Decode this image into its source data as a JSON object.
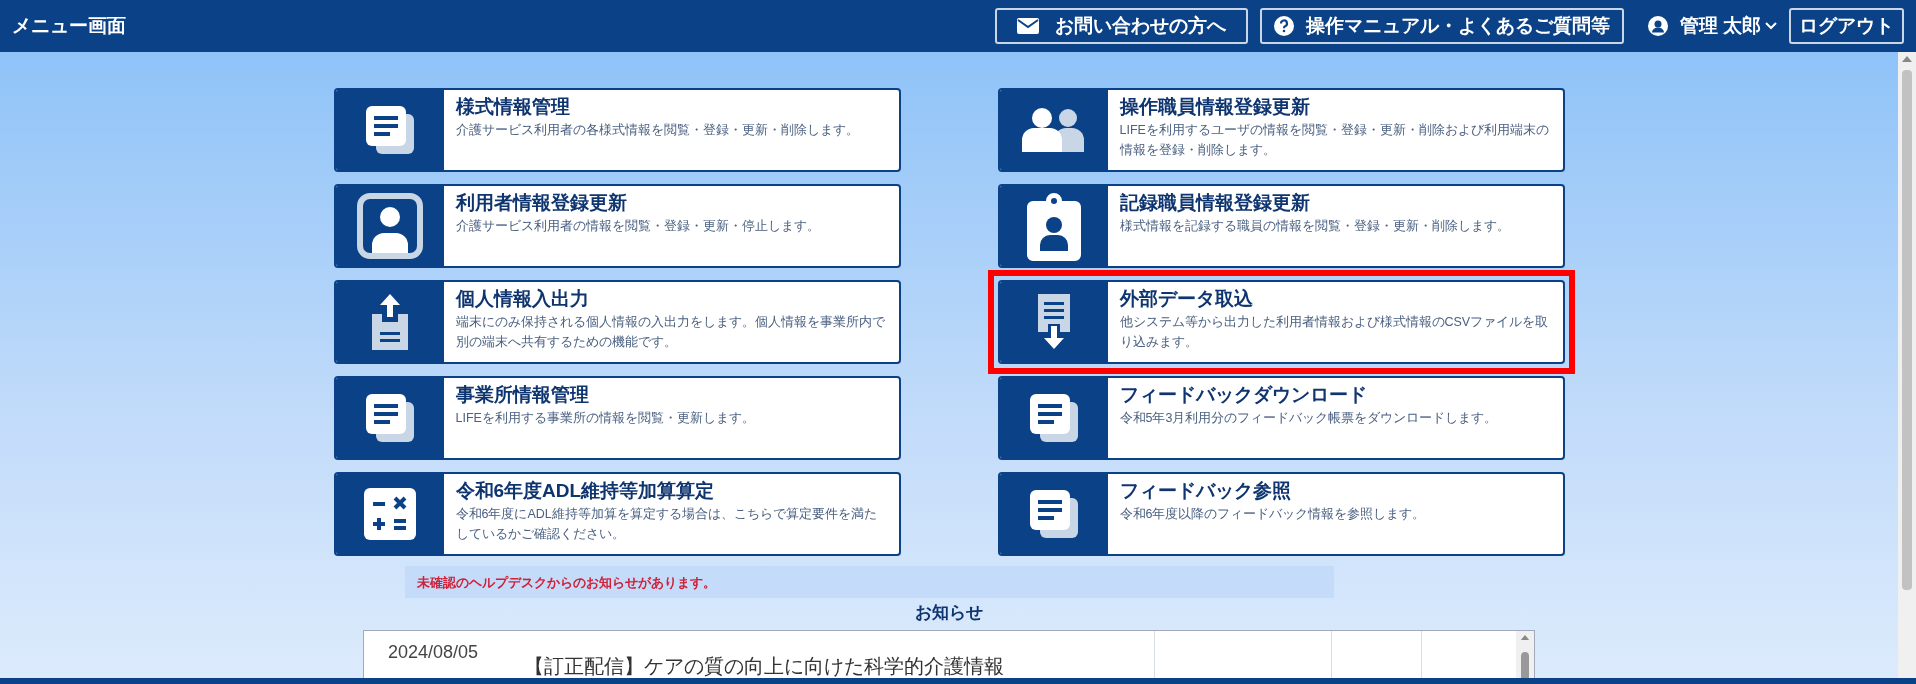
{
  "header": {
    "title": "メニュー画面",
    "contact_button": "お問い合わせの方へ",
    "manual_button": "操作マニュアル・よくあるご質問等",
    "user_name": "管理 太郎",
    "logout_button": "ログアウト"
  },
  "left_cards": [
    {
      "kind": "documents",
      "title": "様式情報管理",
      "description": "介護サービス利用者の各様式情報を閲覧・登録・更新・削除します。",
      "highlighted": false
    },
    {
      "kind": "person",
      "title": "利用者情報登録更新",
      "description": "介護サービス利用者の情報を閲覧・登録・更新・停止します。",
      "highlighted": false
    },
    {
      "kind": "upload",
      "title": "個人情報入出力",
      "description": "端末にのみ保持される個人情報の入出力をします。個人情報を事業所内で別の端末へ共有するための機能です。",
      "highlighted": false
    },
    {
      "kind": "documents",
      "title": "事業所情報管理",
      "description": "LIFEを利用する事業所の情報を閲覧・更新します。",
      "highlighted": false
    },
    {
      "kind": "calculator",
      "title": "令和6年度ADL維持等加算算定",
      "description": "令和6年度にADL維持等加算を算定する場合は、こちらで算定要件を満たしているかご確認ください。",
      "highlighted": false
    }
  ],
  "right_cards": [
    {
      "kind": "people",
      "title": "操作職員情報登録更新",
      "description": "LIFEを利用するユーザの情報を閲覧・登録・更新・削除および利用端末の情報を登録・削除します。",
      "highlighted": false
    },
    {
      "kind": "badge",
      "title": "記録職員情報登録更新",
      "description": "様式情報を記録する職員の情報を閲覧・登録・更新・削除します。",
      "highlighted": false
    },
    {
      "kind": "import",
      "title": "外部データ取込",
      "description": "他システム等から出力した利用者情報および様式情報のCSVファイルを取り込みます。",
      "highlighted": true
    },
    {
      "kind": "documents",
      "title": "フィードバックダウンロード",
      "description": "令和5年3月利用分のフィードバック帳票をダウンロードします。",
      "highlighted": false
    },
    {
      "kind": "documents",
      "title": "フィードバック参照",
      "description": "令和6年度以降のフィードバック情報を参照します。",
      "highlighted": false
    }
  ],
  "alert": "未確認のヘルプデスクからのお知らせがあります。",
  "notices": {
    "heading": "お知らせ",
    "rows": [
      {
        "date": "2024/08/05",
        "title": "【訂正配信】ケアの質の向上に向けた科学的介護情報"
      }
    ]
  }
}
